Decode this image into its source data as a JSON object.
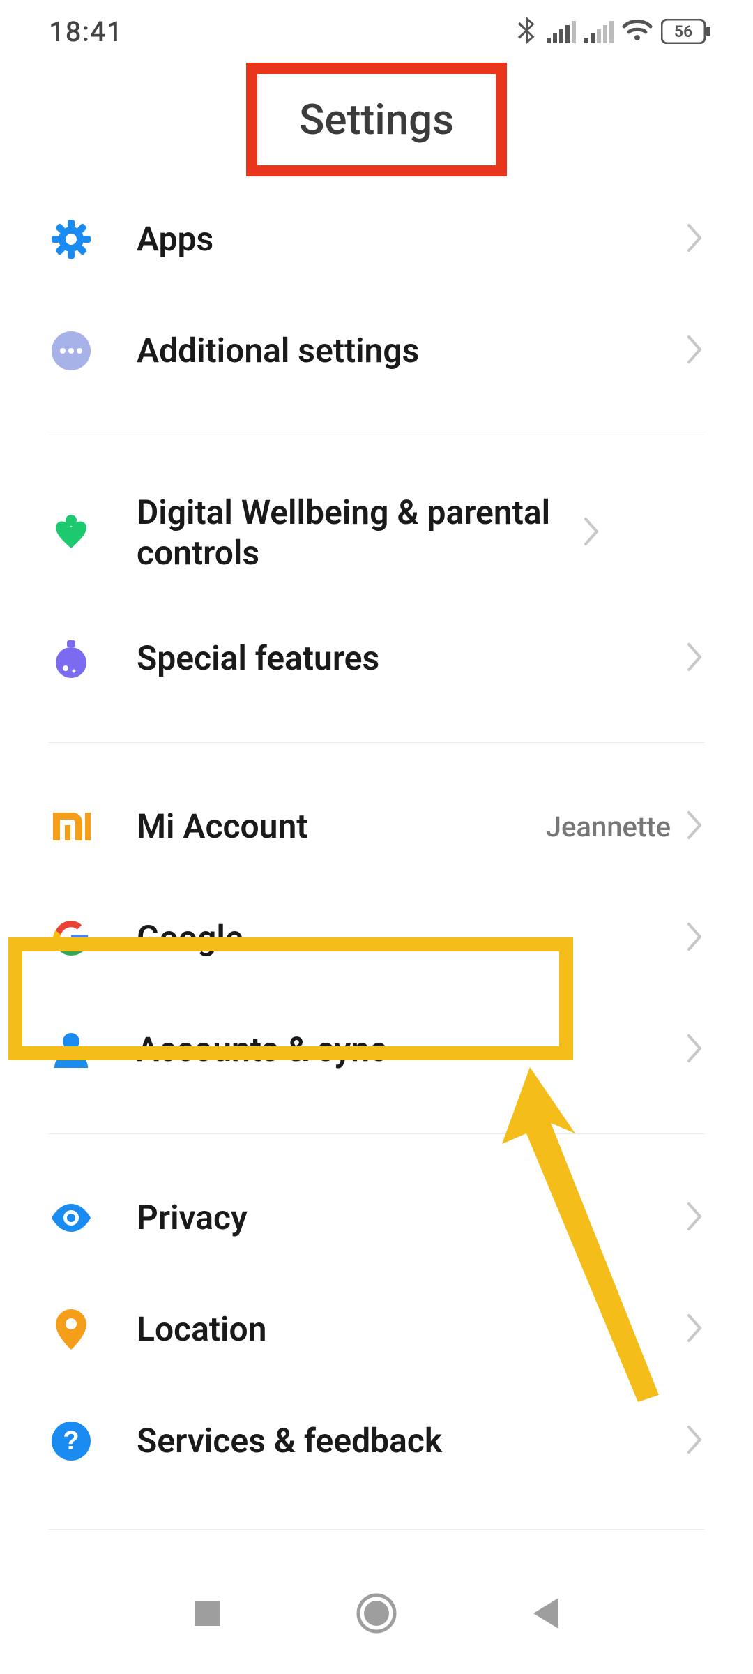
{
  "statusbar": {
    "time": "18:41",
    "battery": "56"
  },
  "page": {
    "title": "Settings"
  },
  "rows": {
    "apps": {
      "label": "Apps"
    },
    "additional": {
      "label": "Additional settings"
    },
    "wellbeing": {
      "label": "Digital Wellbeing & parental controls"
    },
    "special": {
      "label": "Special features"
    },
    "mi_account": {
      "label": "Mi Account",
      "value": "Jeannette"
    },
    "google": {
      "label": "Google"
    },
    "accounts_sync": {
      "label": "Accounts & sync"
    },
    "privacy": {
      "label": "Privacy"
    },
    "location": {
      "label": "Location"
    },
    "services": {
      "label": "Services & feedback"
    }
  },
  "icons": {
    "apps": "gear-icon",
    "additional": "ellipsis-icon",
    "wellbeing": "heart-person-icon",
    "special": "flask-icon",
    "mi_account": "mi-logo-icon",
    "google": "google-icon",
    "accounts_sync": "person-icon",
    "privacy": "eye-icon",
    "location": "pin-icon",
    "services": "help-icon"
  },
  "colors": {
    "highlight_red": "#e8351c",
    "highlight_yellow": "#f5bd1a",
    "blue": "#1a8bf0",
    "purple": "#7a6bf0",
    "green": "#1cc96e",
    "orange": "#f59e1a",
    "lavender": "#a7b2e8"
  },
  "annotations": {
    "highlight_title": true,
    "highlight_google": true,
    "arrow_pointing_to_google": true
  }
}
